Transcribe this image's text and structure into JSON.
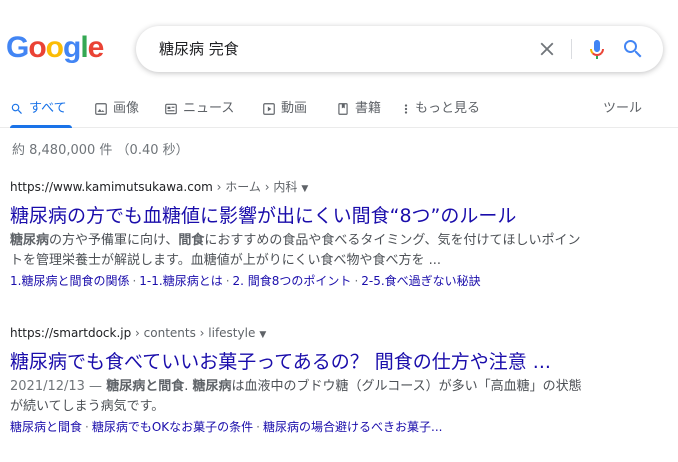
{
  "logo": [
    "G",
    "o",
    "o",
    "g",
    "l",
    "e"
  ],
  "logo_colors": [
    "#4285f4",
    "#ea4335",
    "#fbbc05",
    "#4285f4",
    "#34a853",
    "#ea4335"
  ],
  "search": {
    "query": "糖尿病 完食"
  },
  "tabs": [
    {
      "label": "すべて",
      "icon": "search-icon",
      "active": true
    },
    {
      "label": "画像",
      "icon": "image-icon"
    },
    {
      "label": "ニュース",
      "icon": "news-icon"
    },
    {
      "label": "動画",
      "icon": "play-icon"
    },
    {
      "label": "書籍",
      "icon": "book-icon"
    },
    {
      "label": "もっと見る",
      "icon": "more-vert-icon"
    }
  ],
  "tools_label": "ツール",
  "stats": "約 8,480,000 件 （0.40 秒）",
  "results": [
    {
      "domain": "https://www.kamimutsukawa.com",
      "path": " › ホーム › 内科",
      "title": "糖尿病の方でも血糖値に影響が出にくい間食“8つ”のルール",
      "snippet_parts": [
        {
          "text": "糖尿病",
          "bold": true
        },
        {
          "text": "の方や予備軍に向け、"
        },
        {
          "text": "間食",
          "bold": true
        },
        {
          "text": "におすすめの食品や食べるタイミング、気を付けてほしいポイントを管理栄養士が解説します。血糖値が上がりにくい食べ物や食べ方を ..."
        }
      ],
      "sitelinks": [
        "1.糖尿病と間食の関係",
        "1-1.糖尿病とは",
        "2. 間食8つのポイント",
        "2-5.食べ過ぎない秘訣"
      ]
    },
    {
      "domain": "https://smartdock.jp",
      "path": " › contents › lifestyle",
      "title": "糖尿病でも食べていいお菓子ってあるの？ 間食の仕方や注意 ...",
      "date": "2021/12/13 — ",
      "snippet_parts": [
        {
          "text": "糖尿病と間食",
          "bold": true
        },
        {
          "text": ". "
        },
        {
          "text": "糖尿病",
          "bold": true
        },
        {
          "text": "は血液中のブドウ糖（グルコース）が多い「高血糖」の状態が続いてしまう病気です。"
        }
      ],
      "sitelinks": [
        "糖尿病と間食",
        "糖尿病でもOKなお菓子の条件",
        "糖尿病の場合避けるべきお菓子..."
      ]
    }
  ],
  "colors": {
    "link": "#1a0dab",
    "accent": "#1a73e8",
    "mic_blue": "#4285f4",
    "mic_red": "#ea4335"
  }
}
